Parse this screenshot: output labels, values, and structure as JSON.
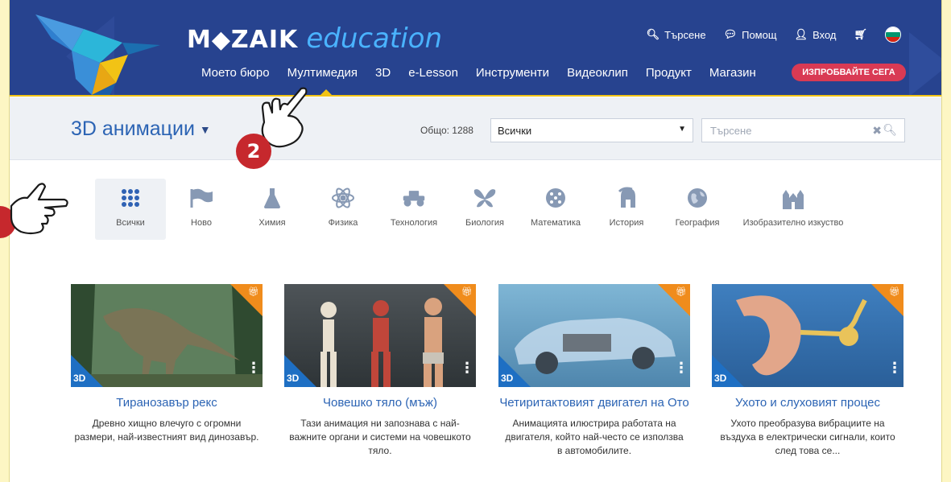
{
  "header": {
    "logo_main": "M◆ZAIK",
    "logo_sub": "education",
    "top_links": [
      {
        "icon": "search-icon",
        "glyph": "🔍︎",
        "label": "Търсене"
      },
      {
        "icon": "help-icon",
        "glyph": "💬︎",
        "label": "Помощ"
      },
      {
        "icon": "user-icon",
        "glyph": "👤︎",
        "label": "Вход"
      },
      {
        "icon": "cart-icon",
        "glyph": "🛒︎",
        "label": ""
      }
    ],
    "nav": [
      "Моето бюро",
      "Мултимедия",
      "3D",
      "e-Lesson",
      "Инструменти",
      "Видеоклип",
      "Продукт",
      "Магазин"
    ],
    "try_button": "ИЗПРОБВАЙТЕ СЕГА",
    "colors": {
      "bar": "#27438f",
      "accent": "#f2c315",
      "button": "#d93a54"
    }
  },
  "subheader": {
    "title": "3D анимации",
    "total": "Общо: 1288",
    "filter_value": "Всички",
    "search_placeholder": "Търсене"
  },
  "categories": [
    {
      "label": "Всички",
      "icon": "grid-icon",
      "active": true
    },
    {
      "label": "Ново",
      "icon": "flag-icon"
    },
    {
      "label": "Химия",
      "icon": "flask-icon"
    },
    {
      "label": "Физика",
      "icon": "atom-icon"
    },
    {
      "label": "Технология",
      "icon": "car-icon"
    },
    {
      "label": "Биология",
      "icon": "butterfly-icon"
    },
    {
      "label": "Математика",
      "icon": "dice-icon"
    },
    {
      "label": "История",
      "icon": "helmet-icon"
    },
    {
      "label": "География",
      "icon": "globe-icon"
    },
    {
      "label": "Изобразително изкуство",
      "icon": "cathedral-icon"
    }
  ],
  "cards": [
    {
      "badge": "3D",
      "title": "Тиранозавър рекс",
      "desc": "Древно хищно влечуго с огромни размери, най-известният вид динозавър."
    },
    {
      "badge": "3D",
      "title": "Човешко тяло (мъж)",
      "desc": "Тази анимация ни запознава с най-важните органи и системи на човешкото тяло."
    },
    {
      "badge": "3D",
      "title": "Четиритактовият двигател на Ото",
      "desc": "Анимацията илюстрира работата на двигателя, който най-често се използва в автомобилите."
    },
    {
      "badge": "3D",
      "title": "Ухото и слуховият процес",
      "desc": "Ухото преобразува вибрациите на въздуха в електрически сигнали, които след това се..."
    }
  ],
  "callouts": {
    "step_number": "2"
  }
}
